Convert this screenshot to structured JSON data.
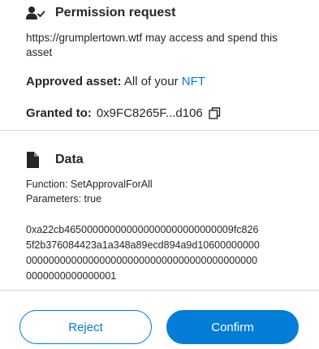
{
  "permission": {
    "heading": "Permission request",
    "description": "https://grumplertown.wtf may access and spend this asset",
    "approved_label": "Approved asset:",
    "approved_value_prefix": "All of your",
    "approved_value_link": "NFT",
    "granted_label": "Granted to:",
    "granted_value": "0x9FC8265F...d106"
  },
  "data_section": {
    "heading": "Data",
    "function_line": "Function: SetApprovalForAll",
    "parameters_line": "Parameters: true",
    "hex_line1": "0xa22cb465000000000000000000000000009fc826",
    "hex_line2": "5f2b376084423a1a348a89ecd894a9d10600000000",
    "hex_line3": "00000000000000000000000000000000000000000",
    "hex_line4": "0000000000000001"
  },
  "actions": {
    "reject_label": "Reject",
    "confirm_label": "Confirm"
  },
  "colors": {
    "accent": "#037dd6",
    "text": "#24272a",
    "divider": "#d6d9dc"
  },
  "icons": {
    "permission": "user-check-icon",
    "data": "document-icon",
    "copy": "copy-icon"
  }
}
